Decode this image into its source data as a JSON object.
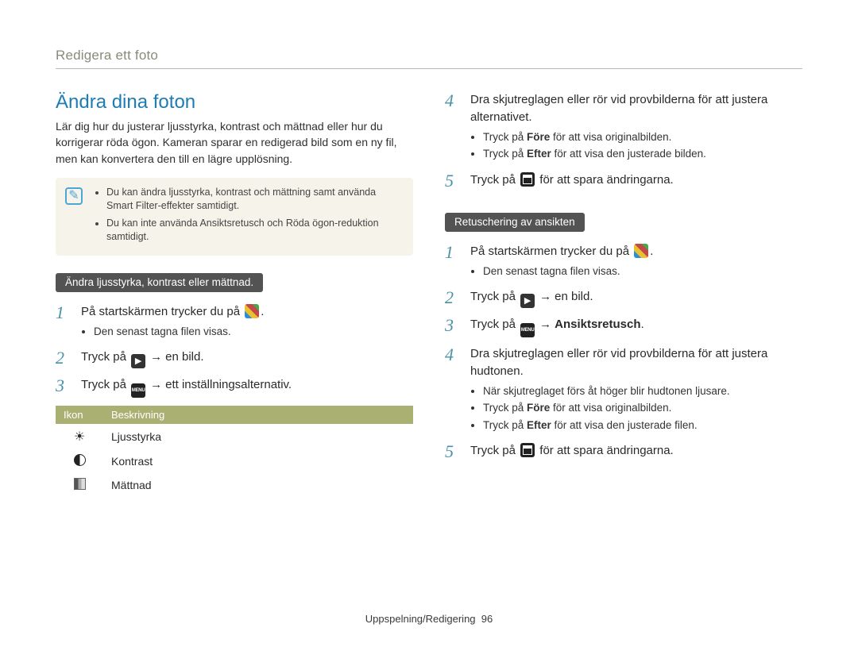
{
  "breadcrumb": "Redigera ett foto",
  "section_title": "Ändra dina foton",
  "intro": "Lär dig hur du justerar ljusstyrka, kontrast och mättnad eller hur du korrigerar röda ögon. Kameran sparar en redigerad bild som en ny fil, men kan konvertera den till en lägre upplösning.",
  "notebox": {
    "items": [
      "Du kan ändra ljusstyrka, kontrast och mättning samt använda Smart Filter-effekter samtidigt.",
      "Du kan inte använda Ansiktsretusch och Röda ögon-reduktion samtidigt."
    ]
  },
  "left": {
    "subheading": "Ändra ljusstyrka, kontrast eller mättnad.",
    "steps": [
      {
        "num": "1",
        "text_before": "På startskärmen trycker du på ",
        "icon": "mosaic-icon",
        "text_after": ".",
        "sub": [
          "Den senast tagna filen visas."
        ]
      },
      {
        "num": "2",
        "text_before": "Tryck på ",
        "icon": "play-icon",
        "arrow": "→",
        "text_after": "en bild."
      },
      {
        "num": "3",
        "text_before": "Tryck på ",
        "icon": "menu-icon",
        "arrow": "→",
        "text_after": "ett inställningsalternativ."
      }
    ],
    "table": {
      "headers": [
        "Ikon",
        "Beskrivning"
      ],
      "rows": [
        {
          "icon": "brightness-icon",
          "desc": "Ljusstyrka"
        },
        {
          "icon": "contrast-icon",
          "desc": "Kontrast"
        },
        {
          "icon": "saturation-icon",
          "desc": "Mättnad"
        }
      ]
    }
  },
  "right": {
    "steps_top": [
      {
        "num": "4",
        "text": "Dra skjutreglagen eller rör vid provbilderna för att justera alternativet.",
        "sub": [
          {
            "before": "Tryck på ",
            "bold": "Före",
            "after": " för att visa originalbilden."
          },
          {
            "before": "Tryck på ",
            "bold": "Efter",
            "after": " för att visa den justerade bilden."
          }
        ]
      },
      {
        "num": "5",
        "text_before": "Tryck på ",
        "icon": "save-icon",
        "text_after": " för att spara ändringarna."
      }
    ],
    "subheading": "Retuschering av ansikten",
    "steps_bottom": [
      {
        "num": "1",
        "text_before": "På startskärmen trycker du på ",
        "icon": "mosaic-icon",
        "text_after": ".",
        "sub_plain": [
          "Den senast tagna filen visas."
        ]
      },
      {
        "num": "2",
        "text_before": "Tryck på ",
        "icon": "play-icon",
        "arrow": "→",
        "text_after": "en bild."
      },
      {
        "num": "3",
        "text_before": "Tryck på ",
        "icon": "menu-icon",
        "arrow": "→",
        "bold_after": "Ansiktsretusch",
        "tail": "."
      },
      {
        "num": "4",
        "text": "Dra skjutreglagen eller rör vid provbilderna för att justera hudtonen.",
        "sub": [
          {
            "plain": "När skjutreglaget förs åt höger blir hudtonen ljusare."
          },
          {
            "before": "Tryck på ",
            "bold": "Före",
            "after": " för att visa originalbilden."
          },
          {
            "before": "Tryck på ",
            "bold": "Efter",
            "after": " för att visa den justerade filen."
          }
        ]
      },
      {
        "num": "5",
        "text_before": "Tryck på ",
        "icon": "save-icon",
        "text_after": " för att spara ändringarna."
      }
    ]
  },
  "icon_labels": {
    "play": "▶",
    "menu": "MENU"
  },
  "footer": {
    "text": "Uppspelning/Redigering",
    "page": "96"
  }
}
